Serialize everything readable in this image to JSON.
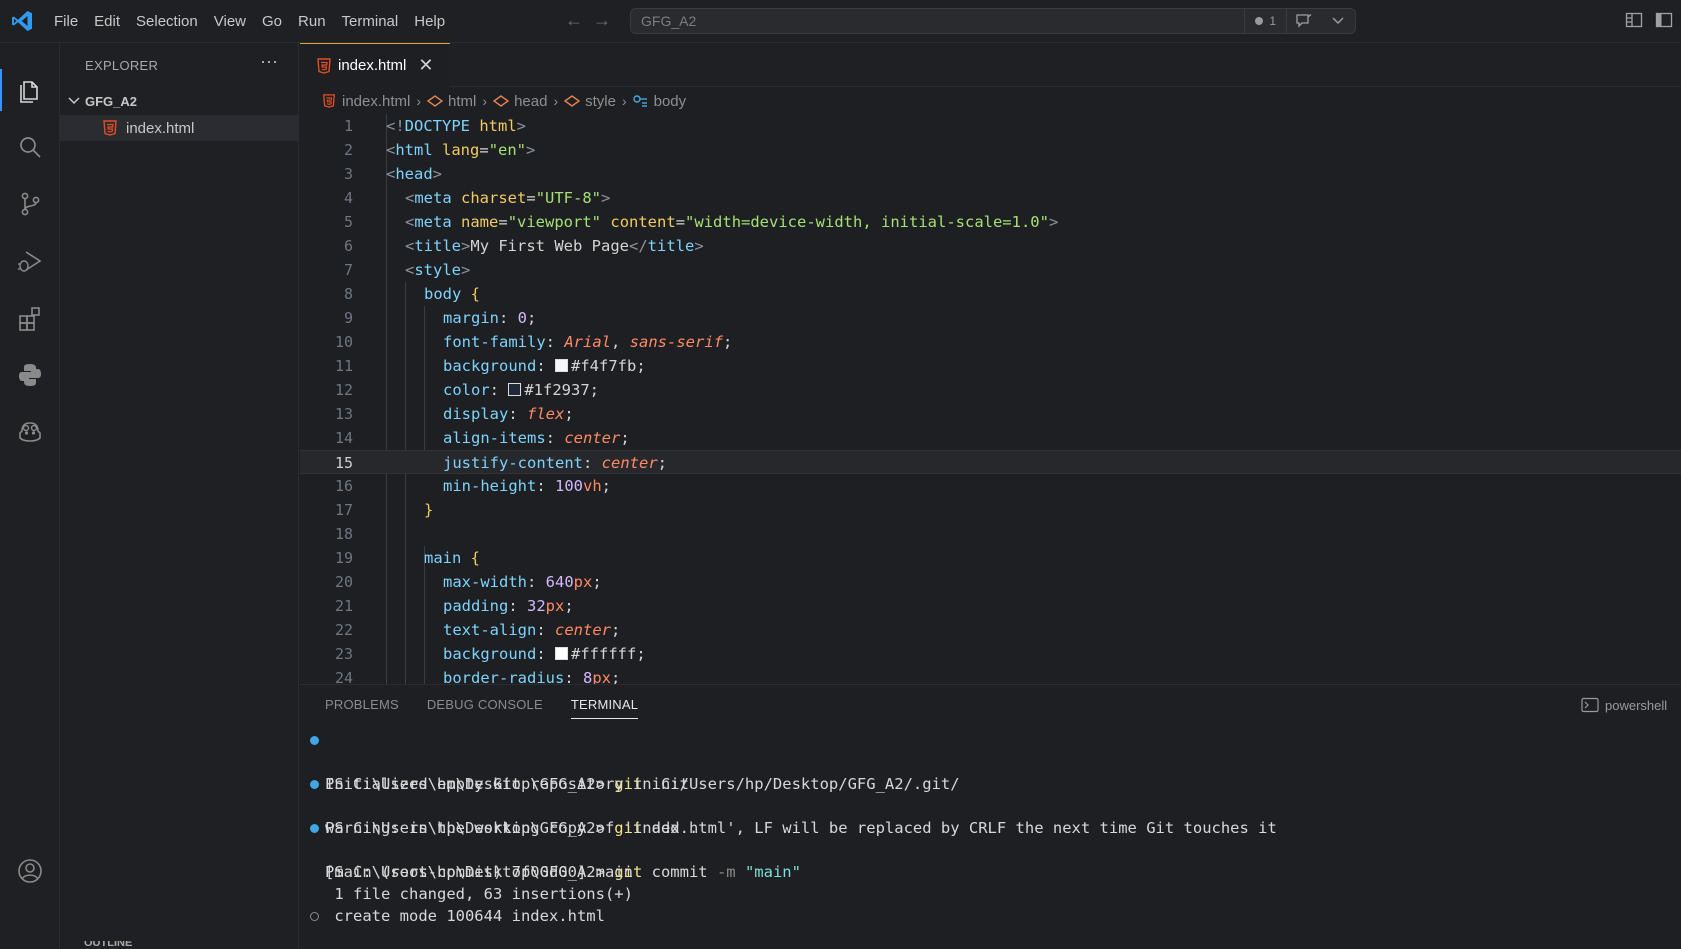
{
  "colors": {
    "accent": "#3794ff",
    "tab_border": "#e0a438",
    "html_icon": "#e44d26"
  },
  "menu": [
    "File",
    "Edit",
    "Selection",
    "View",
    "Go",
    "Run",
    "Terminal",
    "Help"
  ],
  "command_center": {
    "text": "GFG_A2",
    "count": "1"
  },
  "explorer": {
    "title": "EXPLORER",
    "more": "···",
    "folder": "GFG_A2",
    "file": "index.html",
    "outline": "OUTLINE"
  },
  "tab": {
    "label": "index.html",
    "close": "✕"
  },
  "breadcrumb": [
    "index.html",
    "html",
    "head",
    "style",
    "body"
  ],
  "editor": {
    "current_line": 15,
    "lines": [
      {
        "n": "1"
      },
      {
        "n": "2"
      },
      {
        "n": "3"
      },
      {
        "n": "4"
      },
      {
        "n": "5"
      },
      {
        "n": "6"
      },
      {
        "n": "7"
      },
      {
        "n": "8"
      },
      {
        "n": "9"
      },
      {
        "n": "10"
      },
      {
        "n": "11"
      },
      {
        "n": "12"
      },
      {
        "n": "13"
      },
      {
        "n": "14"
      },
      {
        "n": "15"
      },
      {
        "n": "16"
      },
      {
        "n": "17"
      },
      {
        "n": "18"
      },
      {
        "n": "19"
      },
      {
        "n": "20"
      },
      {
        "n": "21"
      },
      {
        "n": "22"
      },
      {
        "n": "23"
      },
      {
        "n": "24"
      }
    ],
    "code": {
      "l1": {
        "open": "<!",
        "kw": "DOCTYPE",
        "sp": " ",
        "html": "html",
        "close": ">"
      },
      "l2": {
        "open": "<",
        "tag": "html",
        "sp": " ",
        "attr": "lang",
        "eq": "=",
        "val": "\"en\"",
        "close": ">"
      },
      "l3": {
        "open": "<",
        "tag": "head",
        "close": ">"
      },
      "l4": {
        "open": "<",
        "tag": "meta",
        "sp": " ",
        "attr": "charset",
        "eq": "=",
        "val": "\"UTF-8\"",
        "close": ">"
      },
      "l5": {
        "open": "<",
        "tag": "meta",
        "sp": " ",
        "attr1": "name",
        "eq1": "=",
        "val1": "\"viewport\"",
        "sp2": " ",
        "attr2": "content",
        "eq2": "=",
        "val2": "\"width=device-width, initial-scale=1.0\"",
        "close": ">"
      },
      "l6": {
        "open": "<",
        "tag": "title",
        "close": ">",
        "text": "My First Web Page",
        "eopen": "</",
        "etag": "title",
        "eclose": ">"
      },
      "l7": {
        "open": "<",
        "tag": "style",
        "close": ">"
      },
      "l8": {
        "sel": "body",
        "brace": " {"
      },
      "l9": {
        "prop": "margin",
        "colon": ": ",
        "num": "0",
        "semi": ";"
      },
      "l10": {
        "prop": "font-family",
        "colon": ": ",
        "v1": "Arial",
        "comma": ", ",
        "v2": "sans-serif",
        "semi": ";"
      },
      "l11": {
        "prop": "background",
        "colon": ": ",
        "swatch": "#f4f7fb",
        "hex": "#f4f7fb",
        "semi": ";"
      },
      "l12": {
        "prop": "color",
        "colon": ": ",
        "swatch": "#1f2937",
        "hex": "#1f2937",
        "semi": ";"
      },
      "l13": {
        "prop": "display",
        "colon": ": ",
        "v": "flex",
        "semi": ";"
      },
      "l14": {
        "prop": "align-items",
        "colon": ": ",
        "v": "center",
        "semi": ";"
      },
      "l15": {
        "prop": "justify-content",
        "colon": ": ",
        "v": "center",
        "semi": ";"
      },
      "l16": {
        "prop": "min-height",
        "colon": ": ",
        "num": "100",
        "unit": "vh",
        "semi": ";"
      },
      "l17": {
        "brace": "}"
      },
      "l19": {
        "sel": "main",
        "brace": " {"
      },
      "l20": {
        "prop": "max-width",
        "colon": ": ",
        "num": "640",
        "unit": "px",
        "semi": ";"
      },
      "l21": {
        "prop": "padding",
        "colon": ": ",
        "num": "32",
        "unit": "px",
        "semi": ";"
      },
      "l22": {
        "prop": "text-align",
        "colon": ": ",
        "v": "center",
        "semi": ";"
      },
      "l23": {
        "prop": "background",
        "colon": ": ",
        "swatch": "#ffffff",
        "hex": "#ffffff",
        "semi": ";"
      },
      "l24": {
        "prop": "border-radius",
        "colon": ": ",
        "num": "8",
        "unit": "px",
        "semi": ";"
      }
    }
  },
  "panel": {
    "tabs": [
      "PROBLEMS",
      "DEBUG CONSOLE",
      "TERMINAL"
    ],
    "active_tab": "TERMINAL",
    "shell": "powershell"
  },
  "terminal": {
    "prompt": "PS C:\\Users\\hp\\Desktop\\GFG_A2> ",
    "cmd1": {
      "cmd": "git",
      "args": " init"
    },
    "out1": "Initialized empty Git repository in C:/Users/hp/Desktop/GFG_A2/.git/",
    "cmd2": {
      "cmd": "git",
      "args": " add ."
    },
    "out2": "warning: in the working copy of 'index.html', LF will be replaced by CRLF the next time Git touches it",
    "cmd3": {
      "cmd": "git",
      "args": " commit ",
      "flag": "-m",
      "sp": " ",
      "quoted": "\"main\""
    },
    "out3": "[main (root-commit) 7f00d00] main",
    "out4": " 1 file changed, 63 insertions(+)",
    "out5": " create mode 100644 index.html"
  }
}
